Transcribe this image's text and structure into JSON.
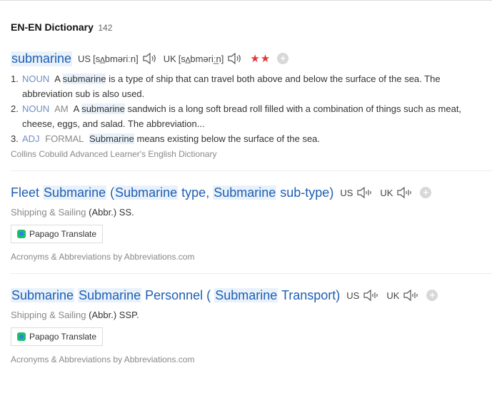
{
  "dictionary": {
    "title": "EN-EN Dictionary",
    "count": "142"
  },
  "entry": {
    "word": "submarine",
    "us_label": "US",
    "us_ipa": "[sʌ̲bməriːn]",
    "uk_label": "UK",
    "uk_ipa": "[sʌ̲bməriː̲n]",
    "stars": "★★",
    "senses": [
      {
        "num": "1.",
        "pos": "NOUN",
        "register": "",
        "pre": "A",
        "hl": "submarine",
        "post": "is a type of ship that can travel both above and below the surface of the sea. The abbreviation sub is also used."
      },
      {
        "num": "2.",
        "pos": "NOUN",
        "register": "AM",
        "pre": "A",
        "hl": "submarine",
        "post": "sandwich is a long soft bread roll filled with a combination of things such as meat, cheese, eggs, and salad. The abbreviation..."
      },
      {
        "num": "3.",
        "pos": "ADJ",
        "register": "FORMAL",
        "pre": "",
        "hl": "Submarine",
        "post": "means existing below the surface of the sea."
      }
    ],
    "source": "Collins Cobuild Advanced Learner's English Dictionary"
  },
  "abbr1": {
    "t1": "Fleet",
    "t2": "Submarine",
    "t3": "(",
    "t4": "Submarine",
    "t5": "type,",
    "t6": "Submarine",
    "t7": "sub-type)",
    "us_label": "US",
    "uk_label": "UK",
    "domain": "Shipping & Sailing",
    "text": "(Abbr.) SS.",
    "papago": "Papago Translate",
    "source": "Acronyms & Abbreviations by Abbreviations.com"
  },
  "abbr2": {
    "t1": "Submarine",
    "t2": "Submarine",
    "t3": "Personnel (",
    "t4": "Submarine",
    "t5": "Transport)",
    "us_label": "US",
    "uk_label": "UK",
    "domain": "Shipping & Sailing",
    "text": "(Abbr.) SSP.",
    "papago": "Papago Translate",
    "source": "Acronyms & Abbreviations by Abbreviations.com"
  },
  "colors": {
    "link": "#1e5eb3",
    "highlight": "#e9f2fb",
    "pos": "#6d8fc4",
    "star": "#e03838"
  }
}
